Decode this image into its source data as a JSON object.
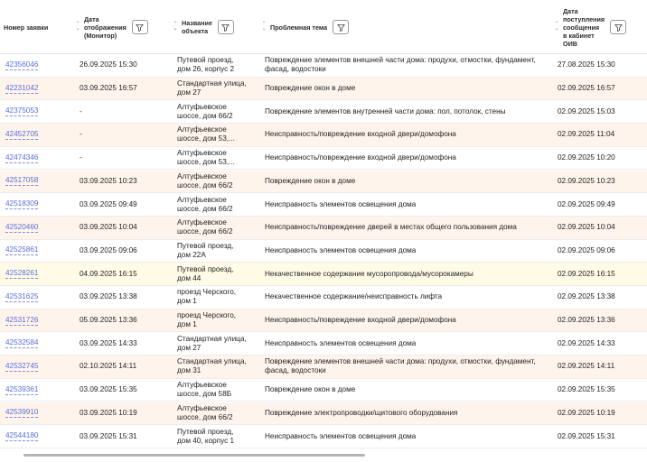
{
  "header": {
    "col1": "Номер заявки",
    "col2": [
      "Дата",
      "отображения",
      "(Монитор)"
    ],
    "col3": [
      "Название",
      "объекта"
    ],
    "col4": "Проблемная тема",
    "col5": [
      "Дата",
      "поступления",
      "сообщения",
      "в кабинет",
      "ОИВ"
    ]
  },
  "icons": {
    "sort": "sort-arrows-icon",
    "filter": "filter-icon"
  },
  "rows": [
    {
      "id": "42356046",
      "monitor_date": "26.09.2025 15:30",
      "object": [
        "Путевой проезд,",
        "дом 26, корпус 2"
      ],
      "topic": [
        "Повреждение элементов внешней части дома: продухи, отмостки, фундамент,",
        "фасад, водостоки"
      ],
      "received": "27.08.2025 15:30"
    },
    {
      "id": "42231042",
      "monitor_date": "03.09.2025 16:57",
      "object": [
        "Стандартная улица,",
        "дом 27"
      ],
      "topic": [
        "Повреждение окон в доме"
      ],
      "received": "02.09.2025 16:57"
    },
    {
      "id": "42375053",
      "monitor_date": "-",
      "object": [
        "Алтуфьевское",
        "шоссе, дом 66/2"
      ],
      "topic": [
        "Повреждение элементов внутренней части дома: пол, потолок, стены"
      ],
      "received": "02.09.2025 15:03"
    },
    {
      "id": "42452705",
      "monitor_date": "-",
      "object": [
        "Алтуфьевское",
        "шоссе, дом 53,..."
      ],
      "topic": [
        "Неисправность/повреждение входной двери/домофона"
      ],
      "received": "02.09.2025 11:04"
    },
    {
      "id": "42474346",
      "monitor_date": "-",
      "object": [
        "Алтуфьевское",
        "шоссе, дом 53,..."
      ],
      "topic": [
        "Неисправность/повреждение входной двери/домофона"
      ],
      "received": "02.09.2025 10:20"
    },
    {
      "id": "42517058",
      "monitor_date": "03.09.2025 10:23",
      "object": [
        "Алтуфьевское",
        "шоссе, дом 66/2"
      ],
      "topic": [
        "Повреждение окон в доме"
      ],
      "received": "02.09.2025 10:23"
    },
    {
      "id": "42518309",
      "monitor_date": "03.09.2025 09:49",
      "object": [
        "Алтуфьевское",
        "шоссе, дом 66/2"
      ],
      "topic": [
        "Неисправность элементов освещения дома"
      ],
      "received": "02.09.2025 09:49"
    },
    {
      "id": "42520460",
      "monitor_date": "03.09.2025 10:04",
      "object": [
        "Алтуфьевское",
        "шоссе, дом 66/2"
      ],
      "topic": [
        "Неисправность/повреждение дверей в местах общего пользования дома"
      ],
      "received": "02.09.2025 10:04"
    },
    {
      "id": "42525861",
      "monitor_date": "03.09.2025 09:06",
      "object": [
        "Путевой проезд,",
        "дом 22А"
      ],
      "topic": [
        "Неисправность элементов освещения дома"
      ],
      "received": "02.09.2025 09:06"
    },
    {
      "id": "42528261",
      "monitor_date": "04.09.2025 16:15",
      "object": [
        "Путевой проезд,",
        "дом 44"
      ],
      "topic": [
        "Некачественное содержание мусоропровода/мусорокамеры"
      ],
      "received": "02.09.2025 16:15"
    },
    {
      "id": "42531625",
      "monitor_date": "03.09.2025 13:38",
      "object": [
        "проезд Черского,",
        "дом 1"
      ],
      "topic": [
        "Некачественное содержание/неисправность лифта"
      ],
      "received": "02.09.2025 13:38"
    },
    {
      "id": "42531726",
      "monitor_date": "05.09.2025 13:36",
      "object": [
        "проезд Черского,",
        "дом 1"
      ],
      "topic": [
        "Неисправность/повреждение входной двери/домофона"
      ],
      "received": "02.09.2025 13:36"
    },
    {
      "id": "42532584",
      "monitor_date": "03.09.2025 14:33",
      "object": [
        "Стандартная улица,",
        "дом 27"
      ],
      "topic": [
        "Неисправность элементов освещения дома"
      ],
      "received": "02.09.2025 14:33"
    },
    {
      "id": "42532745",
      "monitor_date": "02.10.2025 14:11",
      "object": [
        "Стандартная улица,",
        "дом 31"
      ],
      "topic": [
        "Повреждение элементов внешней части дома: продухи, отмостки, фундамент,",
        "фасад, водостоки"
      ],
      "received": "02.09.2025 14:11"
    },
    {
      "id": "42539361",
      "monitor_date": "03.09.2025 15:35",
      "object": [
        "Алтуфьевское",
        "шоссе, дом 58Б"
      ],
      "topic": [
        "Повреждение окон в доме"
      ],
      "received": "02.09.2025 15:35"
    },
    {
      "id": "42539910",
      "monitor_date": "03.09.2025 10:19",
      "object": [
        "Алтуфьевское",
        "шоссе, дом 66/2"
      ],
      "topic": [
        "Повреждение электропроводки/щитового оборудования"
      ],
      "received": "02.09.2025 10:19"
    },
    {
      "id": "42544180",
      "monitor_date": "03.09.2025 15:31",
      "object": [
        "Путевой проезд,",
        "дом 40, корпус 1"
      ],
      "topic": [
        "Неисправность элементов освещения дома"
      ],
      "received": "02.09.2025 15:31"
    }
  ],
  "colors": {
    "link": "#5b6fd6",
    "row_alt": "#fff4ec",
    "row_highlight": "#fffbe6"
  }
}
